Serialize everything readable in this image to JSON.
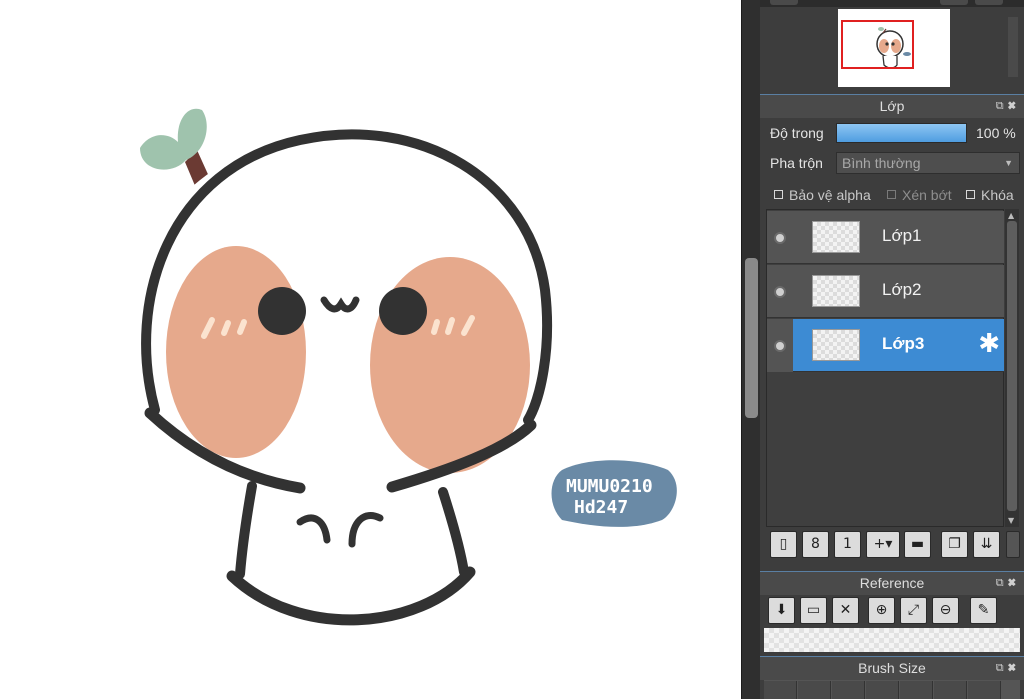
{
  "canvas": {
    "signature_lines": [
      "MUMU0210",
      "Hd247"
    ],
    "colors": {
      "outline": "#323232",
      "blush": "#e6a98c",
      "leaf": "#9fc3ad",
      "stem": "#6b3a33",
      "badge": "#6a8aa6"
    }
  },
  "navigator": {
    "frame_color": "#e02020"
  },
  "layer_panel": {
    "title": "Lớp",
    "opacity_label": "Độ trong",
    "opacity_value": "100 %",
    "opacity_percent": 100,
    "blend_label": "Pha trộn",
    "blend_value": "Bình thường",
    "protect_alpha": "Bảo vệ alpha",
    "clipping": "Xén bớt",
    "lock": "Khóa",
    "layers": [
      {
        "name": "Lớp1",
        "visible": true,
        "active": false
      },
      {
        "name": "Lớp2",
        "visible": true,
        "active": false
      },
      {
        "name": "Lớp3",
        "visible": true,
        "active": true
      }
    ],
    "toolbar_icons": [
      "new-layer-icon",
      "new-8bit-layer-icon",
      "new-1bit-layer-icon",
      "add-layer-dropdown-icon",
      "folder-icon",
      "duplicate-layer-icon",
      "merge-layer-icon"
    ],
    "active_color": "#3d8bd3"
  },
  "reference_panel": {
    "title": "Reference",
    "tool_icons": [
      "load-canvas-icon",
      "open-file-icon",
      "close-icon",
      "zoom-in-icon",
      "fit-icon",
      "zoom-out-icon",
      "eyedropper-icon"
    ]
  },
  "brush_panel": {
    "title": "Brush Size"
  }
}
